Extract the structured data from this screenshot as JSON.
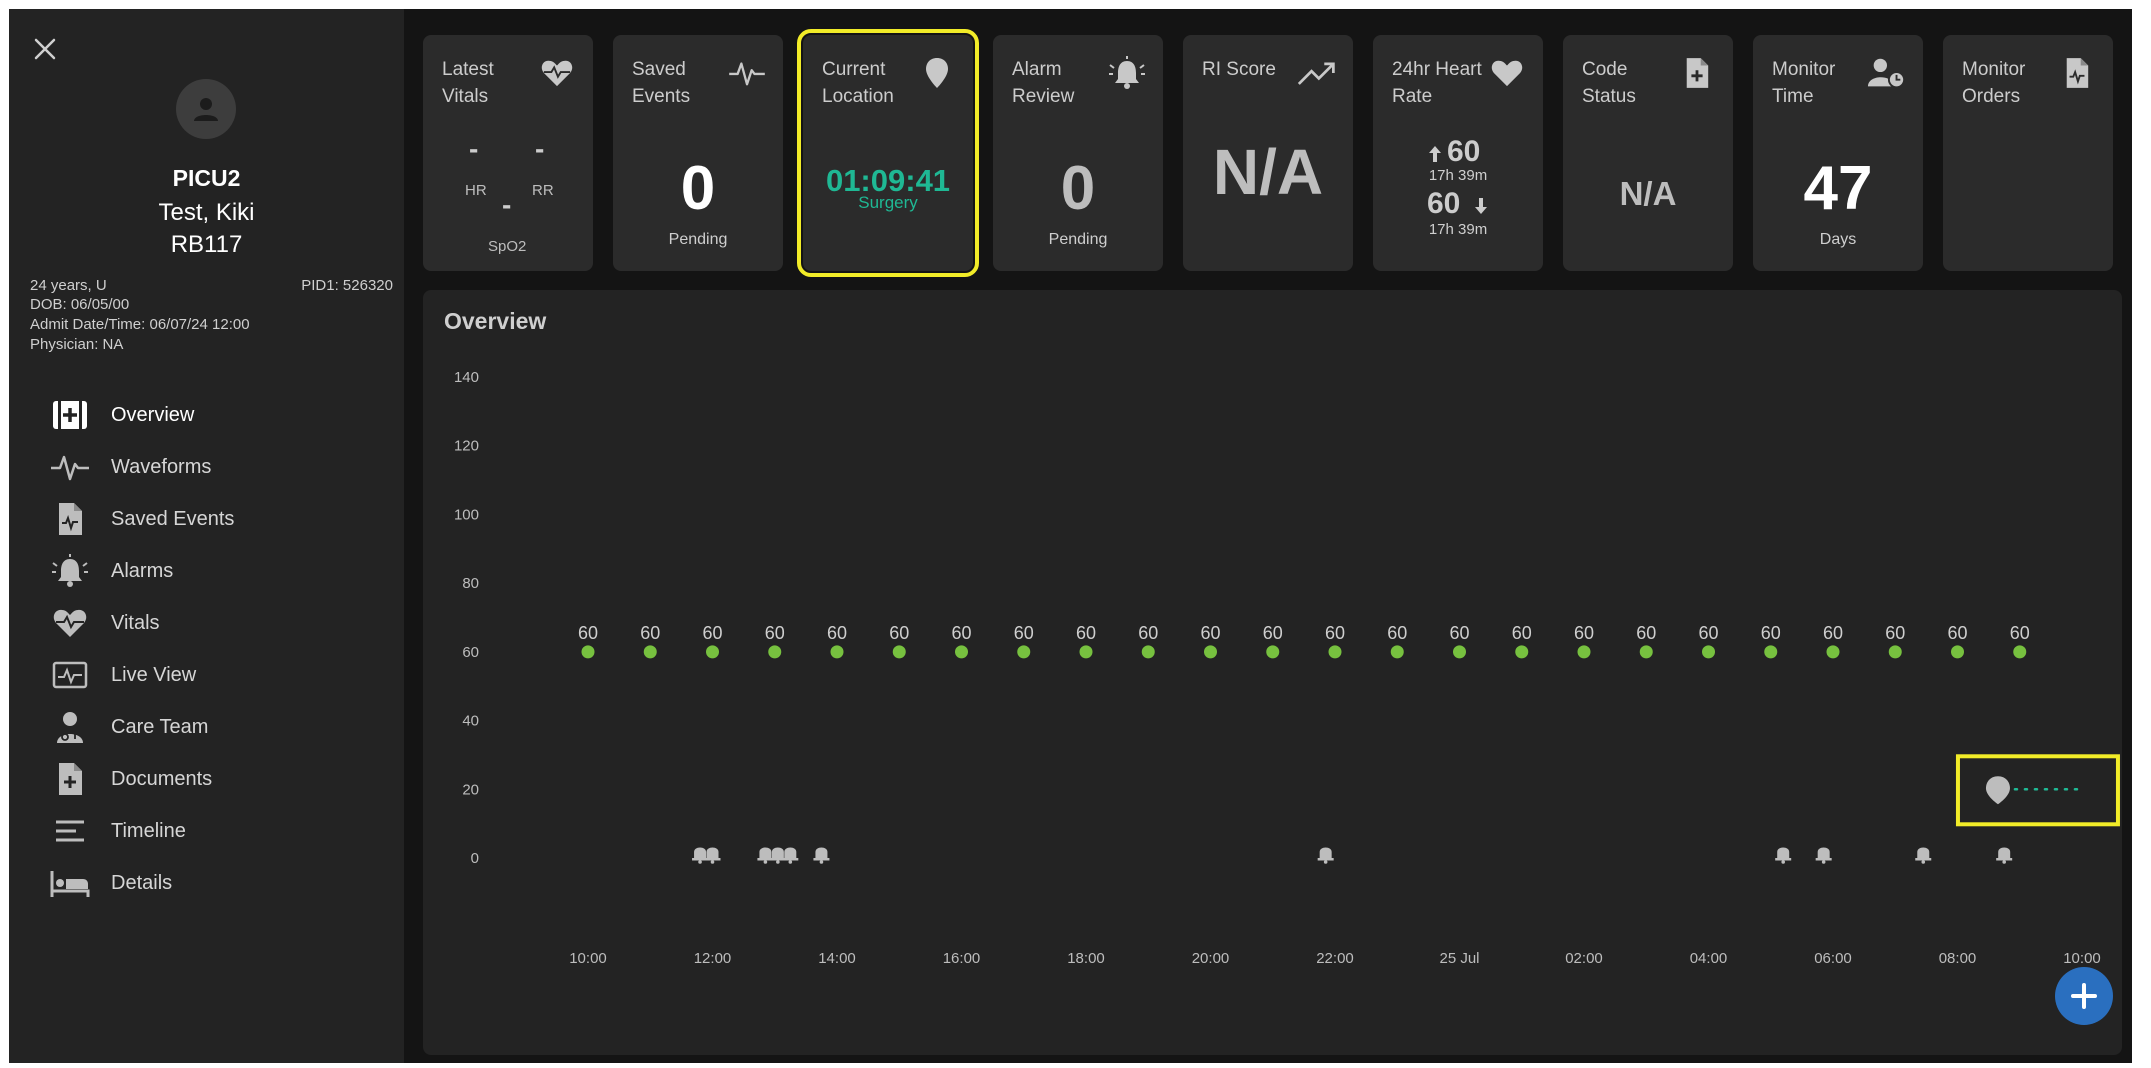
{
  "patient": {
    "unit": "PICU2",
    "name": "Test, Kiki",
    "bed": "RB117",
    "age_sex": "24 years, U",
    "pid": "PID1: 526320",
    "dob": "DOB: 06/05/00",
    "admit": "Admit Date/Time: 06/07/24 12:00",
    "physician": "Physician: NA"
  },
  "nav": [
    {
      "label": "Overview",
      "icon": "overview-icon",
      "active": true
    },
    {
      "label": "Waveforms",
      "icon": "waveform-icon"
    },
    {
      "label": "Saved Events",
      "icon": "saved-events-icon"
    },
    {
      "label": "Alarms",
      "icon": "alarm-icon"
    },
    {
      "label": "Vitals",
      "icon": "vitals-icon"
    },
    {
      "label": "Live View",
      "icon": "live-view-icon"
    },
    {
      "label": "Care Team",
      "icon": "care-team-icon"
    },
    {
      "label": "Documents",
      "icon": "documents-icon"
    },
    {
      "label": "Timeline",
      "icon": "timeline-icon"
    },
    {
      "label": "Details",
      "icon": "details-icon"
    }
  ],
  "tiles": {
    "latest_vitals": {
      "title": "Latest Vitals",
      "hr_value": "-",
      "hr_label": "HR",
      "rr_value": "-",
      "rr_label": "RR",
      "spo2_value": "-",
      "spo2_label": "SpO2"
    },
    "saved_events": {
      "title": "Saved Events",
      "value": "0",
      "sub": "Pending"
    },
    "current_location": {
      "title": "Current Location",
      "value": "01:09:41",
      "sub": "Surgery"
    },
    "alarm_review": {
      "title": "Alarm Review",
      "value": "0",
      "sub": "Pending"
    },
    "ri_score": {
      "title": "RI Score",
      "value": "N/A"
    },
    "heart_rate_24hr": {
      "title": "24hr Heart Rate",
      "high": "60",
      "high_time": "17h 39m",
      "low": "60",
      "low_time": "17h 39m"
    },
    "code_status": {
      "title": "Code Status",
      "value": "N/A"
    },
    "monitor_time": {
      "title": "Monitor Time",
      "value": "47",
      "sub": "Days"
    },
    "monitor_orders": {
      "title": "Monitor Orders"
    }
  },
  "overview": {
    "title": "Overview"
  },
  "colors": {
    "accent_teal": "#1fb894",
    "point_green": "#77c13f",
    "highlight_yellow": "#f2ec28",
    "fab_blue": "#2a6fbf"
  },
  "chart_data": {
    "type": "scatter",
    "title": "Overview",
    "yticks": [
      0,
      20,
      40,
      60,
      80,
      100,
      120,
      140
    ],
    "ylim": [
      0,
      140
    ],
    "xtick_labels": [
      "10:00",
      "12:00",
      "14:00",
      "16:00",
      "18:00",
      "20:00",
      "22:00",
      "25 Jul",
      "02:00",
      "04:00",
      "06:00",
      "08:00",
      "10:00"
    ],
    "xlim_hours": [
      0,
      24
    ],
    "series": [
      {
        "name": "",
        "x_hours": [
          0,
          1,
          2,
          3,
          4,
          5,
          6,
          7,
          8,
          9,
          10,
          11,
          12,
          13,
          14,
          15,
          16,
          17,
          18,
          19,
          20,
          21,
          22,
          23
        ],
        "values": [
          60,
          60,
          60,
          60,
          60,
          60,
          60,
          60,
          60,
          60,
          60,
          60,
          60,
          60,
          60,
          60,
          60,
          60,
          60,
          60,
          60,
          60,
          60,
          60
        ]
      }
    ],
    "alarm_events_hours": [
      1.8,
      2.0,
      2.85,
      3.05,
      3.25,
      3.75,
      11.85,
      19.2,
      19.85,
      21.45,
      22.75
    ],
    "location_marker_hours": 22.65
  }
}
